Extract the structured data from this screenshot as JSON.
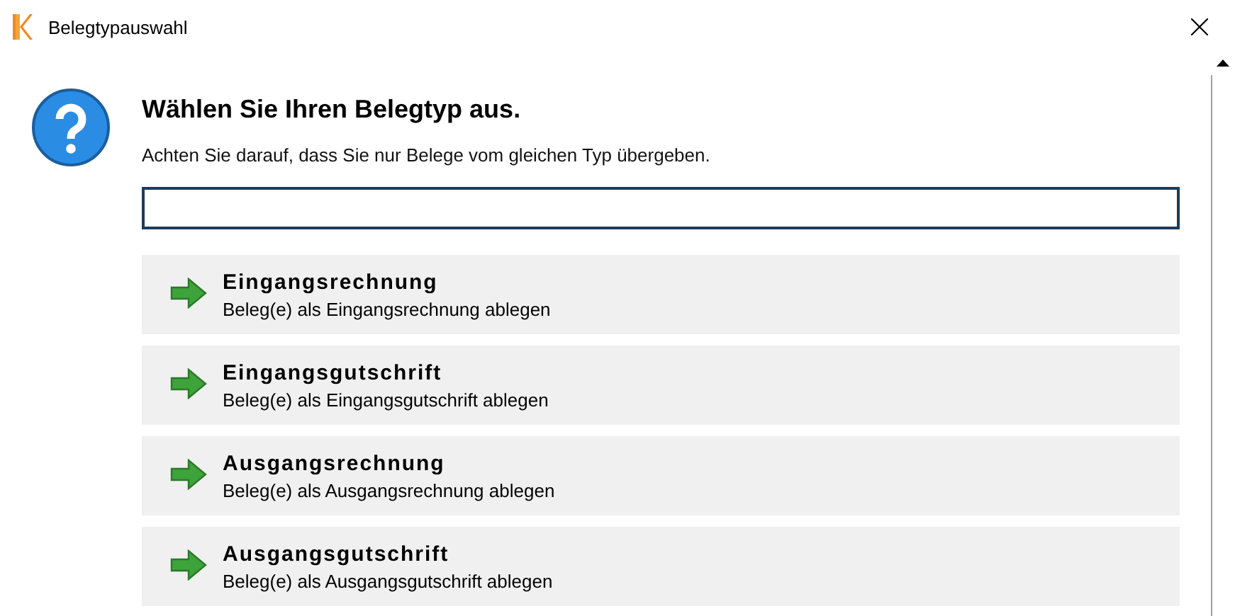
{
  "window": {
    "title": "Belegtypauswahl"
  },
  "heading": "Wählen Sie Ihren Belegtyp aus.",
  "hint": "Achten Sie darauf, dass Sie nur Belege vom gleichen Typ übergeben.",
  "options": [
    {
      "title": "Eingangsrechnung",
      "description": "Beleg(e) als Eingangsrechnung ablegen"
    },
    {
      "title": "Eingangsgutschrift",
      "description": "Beleg(e) als Eingangsgutschrift ablegen"
    },
    {
      "title": "Ausgangsrechnung",
      "description": "Beleg(e) als Ausgangsrechnung ablegen"
    },
    {
      "title": "Ausgangsgutschrift",
      "description": "Beleg(e) als Ausgangsgutschrift ablegen"
    }
  ]
}
